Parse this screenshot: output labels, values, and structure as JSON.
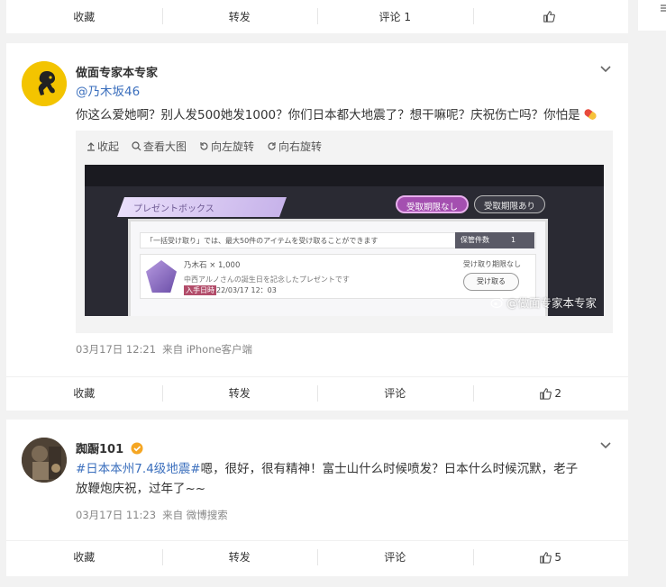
{
  "top_action_bar": {
    "collect": "收藏",
    "forward": "转发",
    "comment": "评论 1",
    "like": ""
  },
  "post1": {
    "username": "做面专家本专家",
    "mention": "@乃木坂46",
    "text": "你这么爱她啊？别人发500她发1000？你们日本都大地震了？想干嘛呢？庆祝伤亡吗？你怕是",
    "media_tools": {
      "collapse": "收起",
      "view_large": "查看大图",
      "rotate_left": "向左旋转",
      "rotate_right": "向右旋转"
    },
    "image": {
      "header": "プレゼントボックス",
      "tab_no_limit": "受取期限なし",
      "tab_with_limit": "受取期限あり",
      "notice": "「一括受け取り」では、最大50件のアイテムを受け取ることができます",
      "stored_label": "保管件数",
      "stored_count": "1",
      "item_name": "乃木石 × 1,000",
      "item_limit": "受け取り期限なし",
      "item_desc": "中西アルノさんの誕生日を記念したプレゼントです",
      "date_label": "入手日時",
      "date_value": "22/03/17 12：03",
      "receive_button": "受け取る",
      "watermark": "@做面专家本专家"
    },
    "date": "03月17日 12:21",
    "source": "来自 iPhone客户端",
    "actions": {
      "collect": "收藏",
      "forward": "转发",
      "comment": "评论",
      "like_count": "2"
    }
  },
  "post2": {
    "username": "踟蹰101",
    "hashtag": "#日本本州7.4级地震#",
    "text_line1": "嗯，很好，很有精神！富士山什么时候喷发？日本什么时候沉默，老子",
    "text_line2": "放鞭炮庆祝，过年了~~",
    "date": "03月17日 11:23",
    "source": "来自 微博搜索",
    "actions": {
      "collect": "收藏",
      "forward": "转发",
      "comment": "评论",
      "like_count": "5"
    }
  },
  "colors": {
    "link": "#eb7350",
    "mention": "#3b6fbd",
    "verified": "#f5a623"
  }
}
